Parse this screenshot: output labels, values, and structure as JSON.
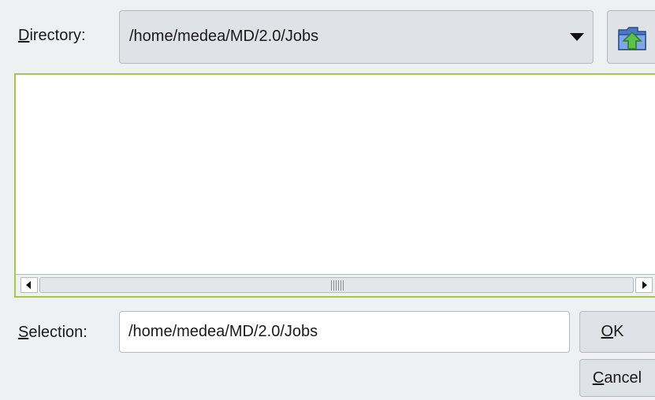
{
  "directory": {
    "label_underlined": "D",
    "label_rest": "irectory:",
    "value": "/home/medea/MD/2.0/Jobs",
    "up_icon": "folder-up-icon"
  },
  "listbox": {
    "items": []
  },
  "selection": {
    "label_underlined": "S",
    "label_rest": "election:",
    "value": "/home/medea/MD/2.0/Jobs"
  },
  "buttons": {
    "ok_underlined": "O",
    "ok_rest": "K",
    "cancel_underlined": "C",
    "cancel_rest": "ancel"
  },
  "colors": {
    "focus_border": "#a3c94a",
    "button_bg": "#dfe2e6",
    "window_bg": "#eef0f2"
  }
}
